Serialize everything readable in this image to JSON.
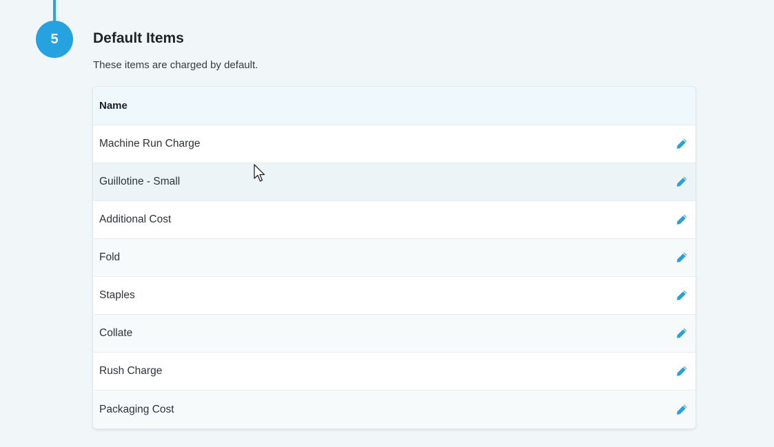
{
  "step": {
    "number": "5",
    "title": "Default Items",
    "subtitle": "These items are charged by default."
  },
  "table": {
    "header": "Name",
    "rows": [
      {
        "name": "Machine Run Charge",
        "action_icon": "pencil-icon"
      },
      {
        "name": "Guillotine - Small",
        "action_icon": "pencil-icon"
      },
      {
        "name": "Additional Cost",
        "action_icon": "pencil-icon"
      },
      {
        "name": "Fold",
        "action_icon": "pencil-icon"
      },
      {
        "name": "Staples",
        "action_icon": "pencil-icon"
      },
      {
        "name": "Collate",
        "action_icon": "pencil-icon"
      },
      {
        "name": "Rush Charge",
        "action_icon": "pencil-icon"
      },
      {
        "name": "Packaging Cost",
        "action_icon": "pencil-icon"
      }
    ]
  },
  "colors": {
    "accent": "#27a2e0",
    "background": "#f1f6f8",
    "header_bg": "#eff8fc",
    "icon": "#2a9fd8"
  }
}
